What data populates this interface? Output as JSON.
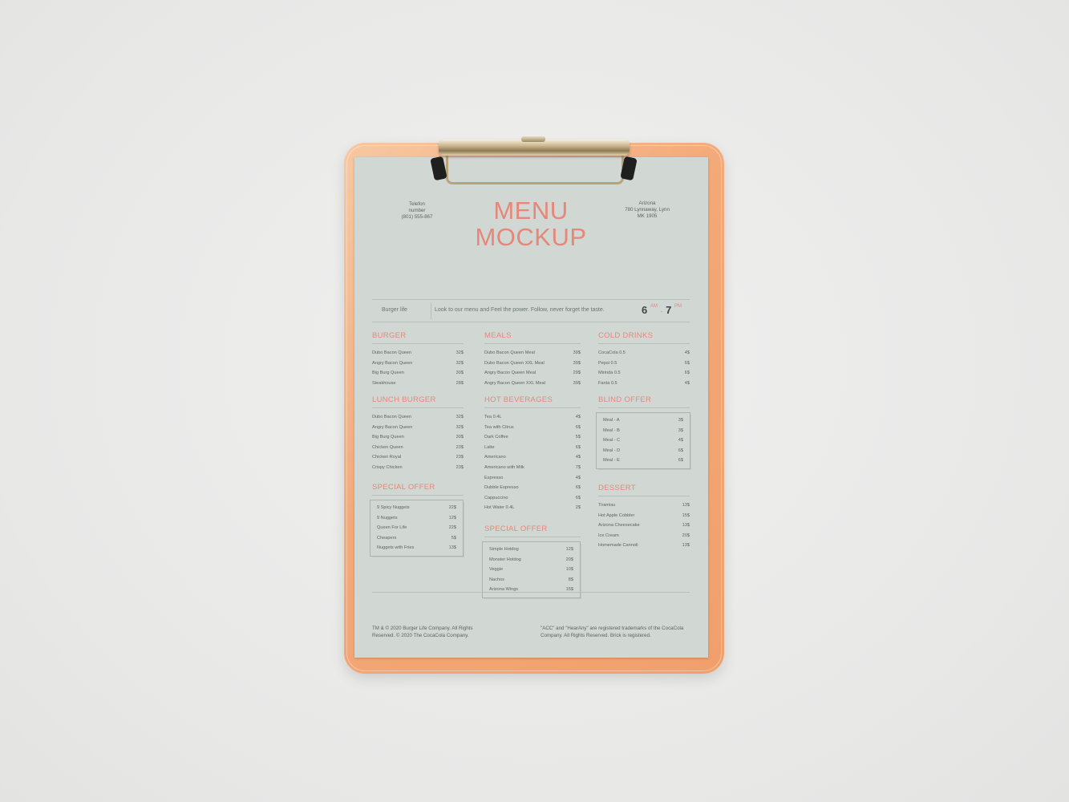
{
  "header": {
    "left": [
      "Telefon",
      "number",
      "(801) 555-867"
    ],
    "title_line1": "MENU",
    "title_line2": "MOCKUP",
    "right": [
      "Arizona",
      "780 Lynnaway, Lynn",
      "MK 1905"
    ]
  },
  "strip": {
    "tag": "Burger life",
    "slogan": "Look to our menu and Feel the power. Follow, never forget the taste.",
    "open_hour": "6",
    "open_suffix": "AM",
    "dash": "-",
    "close_hour": "7",
    "close_suffix": "PM"
  },
  "sections": {
    "burger": {
      "title": "BURGER",
      "items": [
        {
          "name": "Dubo Bacon Queen",
          "price": "32$"
        },
        {
          "name": "Angry Bacon Queen",
          "price": "32$"
        },
        {
          "name": "Big Burg Queen",
          "price": "30$"
        },
        {
          "name": "Steakhouse",
          "price": "28$"
        }
      ]
    },
    "lunch_burger": {
      "title": "LUNCH BURGER",
      "items": [
        {
          "name": "Dubo Bacon Queen",
          "price": "32$"
        },
        {
          "name": "Angry Bacon Queen",
          "price": "32$"
        },
        {
          "name": "Big Burg Queen",
          "price": "30$"
        },
        {
          "name": "Chicken Queen",
          "price": "23$"
        },
        {
          "name": "Chicken Royal",
          "price": "23$"
        },
        {
          "name": "Crispy Chicken",
          "price": "23$"
        }
      ]
    },
    "special_offer_left": {
      "title": "SPECIAL OFFER",
      "items": [
        {
          "name": "9 Spicy Nuggets",
          "price": "22$"
        },
        {
          "name": "9 Nuggets",
          "price": "12$"
        },
        {
          "name": "Queen For Life",
          "price": "22$"
        },
        {
          "name": "Cheapers",
          "price": "5$"
        },
        {
          "name": "Nuggets with Fries",
          "price": "13$"
        }
      ]
    },
    "meals": {
      "title": "MEALS",
      "items": [
        {
          "name": "Dubo Bacon Queen Meal",
          "price": "39$"
        },
        {
          "name": "Dubo Bacon Queen XXL Meal",
          "price": "39$"
        },
        {
          "name": "Angry Bacon Queen Meal",
          "price": "29$"
        },
        {
          "name": "Angry Bacon Queen XXL Meal",
          "price": "39$"
        }
      ]
    },
    "hot_beverages": {
      "title": "HOT BEVERAGES",
      "items": [
        {
          "name": "Tea 0.4L",
          "price": "4$"
        },
        {
          "name": "Tea with Citrus",
          "price": "6$"
        },
        {
          "name": "Dark Coffee",
          "price": "5$"
        },
        {
          "name": "Latte",
          "price": "6$"
        },
        {
          "name": "Americano",
          "price": "4$"
        },
        {
          "name": "Americano with Milk",
          "price": "7$"
        },
        {
          "name": "Espresso",
          "price": "4$"
        },
        {
          "name": "Dubble Espresso",
          "price": "6$"
        },
        {
          "name": "Cappuccino",
          "price": "6$"
        },
        {
          "name": "Hot Water 0.4L",
          "price": "2$"
        }
      ]
    },
    "special_offer_mid": {
      "title": "SPECIAL OFFER",
      "items": [
        {
          "name": "Simple Hotdog",
          "price": "12$"
        },
        {
          "name": "Monster Hotdog",
          "price": "20$"
        },
        {
          "name": "Veggie",
          "price": "10$"
        },
        {
          "name": "Nachos",
          "price": "8$"
        },
        {
          "name": "Arizona Wings",
          "price": "15$"
        }
      ]
    },
    "cold_drinks": {
      "title": "COLD DRINKS",
      "items": [
        {
          "name": "CocaCola 0.5",
          "price": "4$"
        },
        {
          "name": "Pepsi 0.5",
          "price": "5$"
        },
        {
          "name": "Mirinda 0.5",
          "price": "6$"
        },
        {
          "name": "Fanta 0.5",
          "price": "4$"
        }
      ]
    },
    "blind_offer": {
      "title": "BLIND OFFER",
      "items": [
        {
          "name": "Meal - A",
          "price": "3$"
        },
        {
          "name": "Meal - B",
          "price": "3$"
        },
        {
          "name": "Meal - C",
          "price": "4$"
        },
        {
          "name": "Meal - D",
          "price": "6$"
        },
        {
          "name": "Meal - E",
          "price": "6$"
        }
      ]
    },
    "dessert": {
      "title": "DESSERT",
      "items": [
        {
          "name": "Tiramisu",
          "price": "13$"
        },
        {
          "name": "Hot Apple Cobbler",
          "price": "15$"
        },
        {
          "name": "Arizona Cheesecake",
          "price": "13$"
        },
        {
          "name": "Ice Cream",
          "price": "20$"
        },
        {
          "name": "Homemade Cannoli",
          "price": "13$"
        }
      ]
    }
  },
  "footer": {
    "left": [
      "TM & © 2020 Burger Life Company. All Rights",
      "Reserved. © 2020 The CocaCola Company."
    ],
    "right": [
      "\"ACC\" and \"HearAny\" are registered trademarks of the CocaCola",
      "Company. All Rights Reserved. Brick is registered."
    ]
  }
}
